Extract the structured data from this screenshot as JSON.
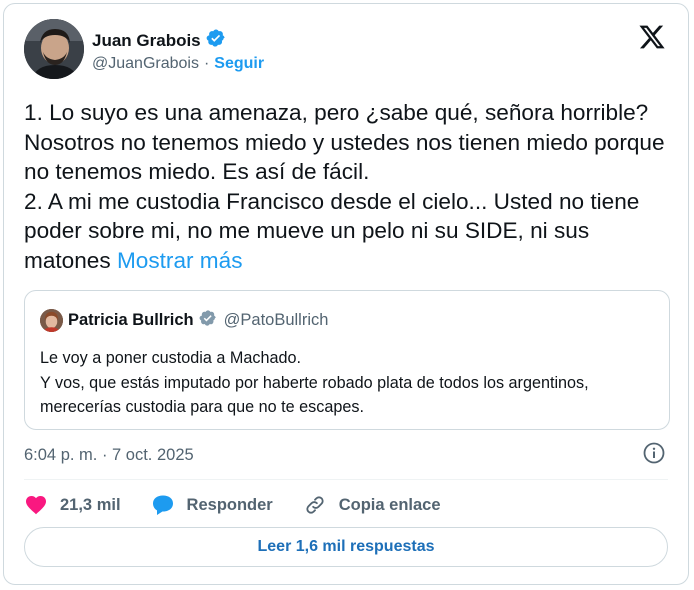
{
  "author": {
    "name": "Juan Grabois",
    "handle": "@JuanGrabois",
    "separator": "·",
    "follow_label": "Seguir",
    "verified": true
  },
  "post": {
    "lines": [
      "1. Lo suyo es una amenaza, pero ¿sabe qué, señora horrible? Nosotros no tenemos miedo y ustedes nos tienen miedo porque no tenemos miedo. Es así de fácil.",
      "2. A mi me custodia Francisco desde el cielo... Usted no tiene poder sobre mi, no me mueve un pelo ni su SIDE, ni sus matones"
    ],
    "show_more_label": "Mostrar más"
  },
  "quoted": {
    "name": "Patricia Bullrich",
    "handle": "@PatoBullrich",
    "verified": true,
    "lines": [
      "Le voy a poner custodia a Machado.",
      "Y vos, que estás imputado por haberte robado plata de todos los argentinos, merecerías custodia para que no te escapes."
    ]
  },
  "meta": {
    "timestamp": "6:04 p. m. · 7 oct. 2025"
  },
  "actions": {
    "likes": "21,3 mil",
    "reply_label": "Responder",
    "copy_label": "Copia enlace"
  },
  "read_replies_label": "Leer 1,6 mil respuestas",
  "colors": {
    "accent": "#1d9bf0",
    "like": "#f91880",
    "text": "#0f1419",
    "muted": "#536471",
    "border": "#cfd9de"
  },
  "icons": [
    "verified-badge-icon",
    "x-logo-icon",
    "info-icon",
    "heart-icon",
    "reply-bubble-icon",
    "link-icon"
  ]
}
